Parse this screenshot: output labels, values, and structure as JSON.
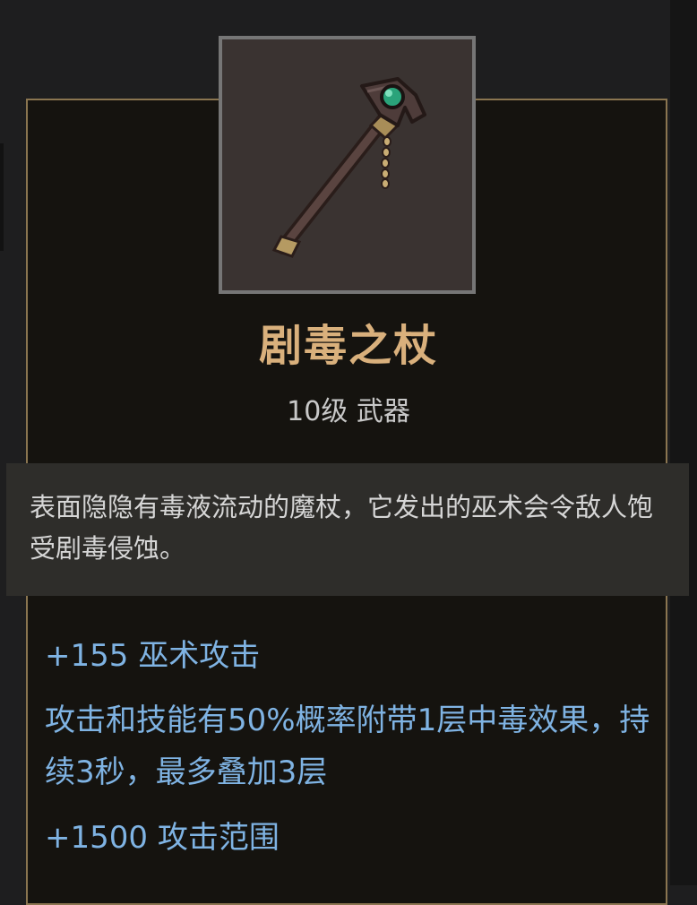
{
  "item": {
    "icon": "poison-staff-icon",
    "name": "剧毒之杖",
    "level_type": "10级 武器",
    "description": "表面隐隐有毒液流动的魔杖，它发出的巫术会令敌人饱受剧毒侵蚀。",
    "stats": {
      "witchcraft_attack": "+155 巫术攻击",
      "poison_effect": "攻击和技能有50%概率附带1层中毒效果，持续3秒，最多叠加3层",
      "attack_range": "+1500 攻击范围"
    }
  },
  "colors": {
    "title": "#d9b07c",
    "stat_text": "#7fb3e3",
    "frame_border": "#8a7550",
    "gem": "#2aa37a"
  }
}
